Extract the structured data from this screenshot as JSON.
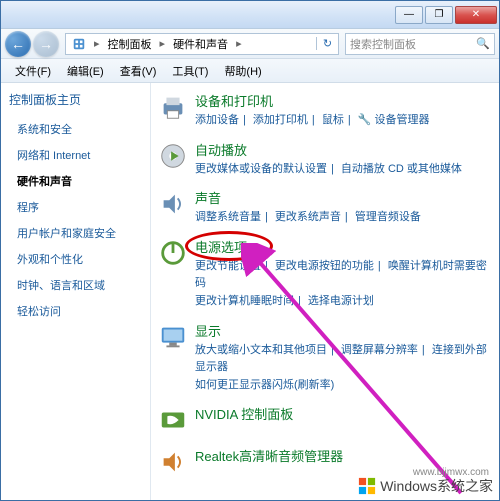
{
  "titlebar": {
    "min": "—",
    "max": "❐",
    "close": "✕"
  },
  "nav": {
    "back": "←",
    "forward": "→"
  },
  "breadcrumb": {
    "seg1": "控制面板",
    "seg2": "硬件和声音",
    "refresh": "↻"
  },
  "search": {
    "placeholder": "搜索控制面板",
    "icon": "🔍"
  },
  "menu": {
    "file": "文件(F)",
    "edit": "编辑(E)",
    "view": "查看(V)",
    "tools": "工具(T)",
    "help": "帮助(H)"
  },
  "sidebar": {
    "home": "控制面板主页",
    "items": [
      "系统和安全",
      "网络和 Internet",
      "硬件和声音",
      "程序",
      "用户帐户和家庭安全",
      "外观和个性化",
      "时钟、语言和区域",
      "轻松访问"
    ],
    "active_index": 2
  },
  "categories": [
    {
      "title": "设备和打印机",
      "links": [
        "添加设备",
        "添加打印机",
        "鼠标",
        "🔧 设备管理器"
      ]
    },
    {
      "title": "自动播放",
      "links": [
        "更改媒体或设备的默认设置",
        "自动播放 CD 或其他媒体"
      ]
    },
    {
      "title": "声音",
      "links": [
        "调整系统音量",
        "更改系统声音",
        "管理音频设备"
      ]
    },
    {
      "title": "电源选项",
      "links": [
        "更改节能设置",
        "更改电源按钮的功能",
        "唤醒计算机时需要密码",
        "更改计算机睡眠时间",
        "选择电源计划"
      ]
    },
    {
      "title": "显示",
      "links": [
        "放大或缩小文本和其他项目",
        "调整屏幕分辨率",
        "连接到外部显示器",
        "如何更正显示器闪烁(刷新率)"
      ]
    },
    {
      "title": "NVIDIA 控制面板",
      "links": []
    },
    {
      "title": "Realtek高清晰音频管理器",
      "links": []
    }
  ],
  "watermark": {
    "text": "Windows系统之家",
    "url": "www.bjjmwx.com"
  }
}
